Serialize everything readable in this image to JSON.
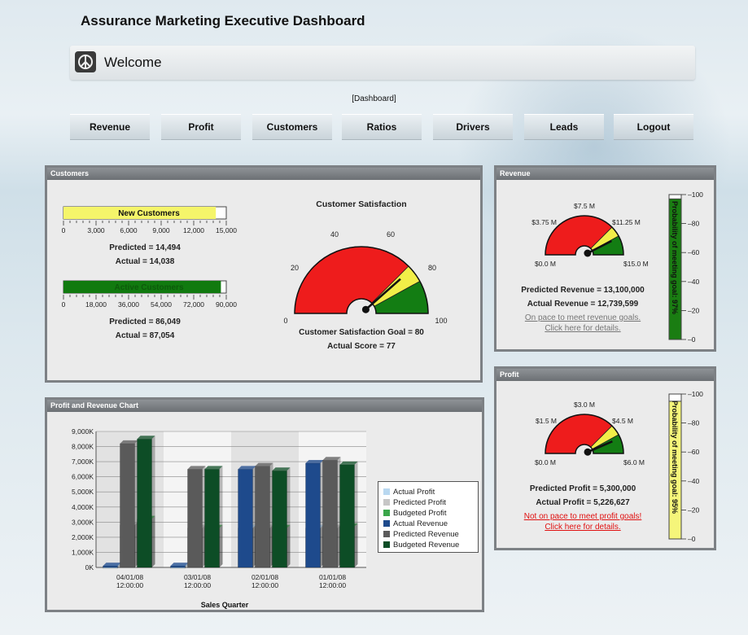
{
  "header": {
    "title": "Assurance Marketing Executive Dashboard",
    "welcome": "Welcome",
    "breadcrumb": "[Dashboard]"
  },
  "nav": {
    "items": [
      "Revenue",
      "Profit",
      "Customers",
      "Ratios",
      "Drivers",
      "Leads",
      "Logout"
    ]
  },
  "customers_panel": {
    "title": "Customers",
    "new_customers": {
      "label": "New Customers",
      "fraction": 0.936,
      "ticks": [
        "0",
        "3,000",
        "6,000",
        "9,000",
        "12,000",
        "15,000"
      ],
      "predicted": "Predicted = 14,494",
      "actual": "Actual = 14,038"
    },
    "active_customers": {
      "label": "Active Customers",
      "fraction": 0.967,
      "ticks": [
        "0",
        "18,000",
        "36,000",
        "54,000",
        "72,000",
        "90,000"
      ],
      "predicted": "Predicted = 86,049",
      "actual": "Actual = 87,054"
    },
    "satisfaction": {
      "title": "Customer Satisfaction",
      "ticks": [
        "0",
        "20",
        "40",
        "60",
        "80",
        "100"
      ],
      "goal_text": "Customer Satisfaction Goal = 80",
      "actual_text": "Actual Score = 77",
      "value": 77
    }
  },
  "revenue_panel": {
    "title": "Revenue",
    "gauge_labels": [
      "$0.0 M",
      "$3.75 M",
      "$7.5 M",
      "$11.25 M",
      "$15.0 M"
    ],
    "predicted": "Predicted Revenue = 13,100,000",
    "actual": "Actual Revenue = 12,739,599",
    "link1": "On pace to meet revenue goals.",
    "link2": "Click here for details.",
    "probability_label": "Probability of meeting goal: 97%",
    "probability": 0.97,
    "scale": [
      "100",
      "80",
      "60",
      "40",
      "20",
      "0"
    ],
    "color": "#1a7d12",
    "value_fraction": 0.85
  },
  "profit_panel": {
    "title": "Profit",
    "gauge_labels": [
      "$0.0 M",
      "$1.5 M",
      "$3.0 M",
      "$4.5 M",
      "$6.0 M"
    ],
    "predicted": "Predicted Profit = 5,300,000",
    "actual": "Actual Profit = 5,226,627",
    "link1": "Not on pace to meet profit goals!",
    "link2": "Click here for details.",
    "probability_label": "Probability of meeting goal: 95%",
    "probability": 0.95,
    "scale": [
      "100",
      "80",
      "60",
      "40",
      "20",
      "0"
    ],
    "color": "#f5f57a",
    "value_fraction": 0.87
  },
  "chart_panel": {
    "title": "Profit and Revenue Chart"
  },
  "chart_data": {
    "type": "bar",
    "xlabel": "Sales Quarter",
    "ylim": [
      0,
      9000
    ],
    "y_ticks": [
      "0K",
      "1,000K",
      "2,000K",
      "3,000K",
      "4,000K",
      "5,000K",
      "6,000K",
      "7,000K",
      "8,000K",
      "9,000K"
    ],
    "categories": [
      [
        "04/01/08",
        "12:00:00"
      ],
      [
        "03/01/08",
        "12:00:00"
      ],
      [
        "02/01/08",
        "12:00:00"
      ],
      [
        "01/01/08",
        "12:00:00"
      ]
    ],
    "series": [
      {
        "name": "Actual Profit",
        "color": "#b9d8f0",
        "values": [
          0,
          0,
          2600,
          2600
        ]
      },
      {
        "name": "Predicted Profit",
        "color": "#c6c6c6",
        "values": [
          2800,
          2600,
          2600,
          2600
        ]
      },
      {
        "name": "Budgeted Profit",
        "color": "#3aa64a",
        "values": [
          3200,
          2600,
          2600,
          2700
        ]
      },
      {
        "name": "Actual Revenue",
        "color": "#1e4a8c",
        "values": [
          100,
          100,
          6500,
          6900
        ]
      },
      {
        "name": "Predicted Revenue",
        "color": "#5a5a5a",
        "values": [
          8200,
          6500,
          6700,
          7100
        ]
      },
      {
        "name": "Budgeted Revenue",
        "color": "#0d4d26",
        "values": [
          8500,
          6500,
          6400,
          6800
        ]
      }
    ]
  }
}
